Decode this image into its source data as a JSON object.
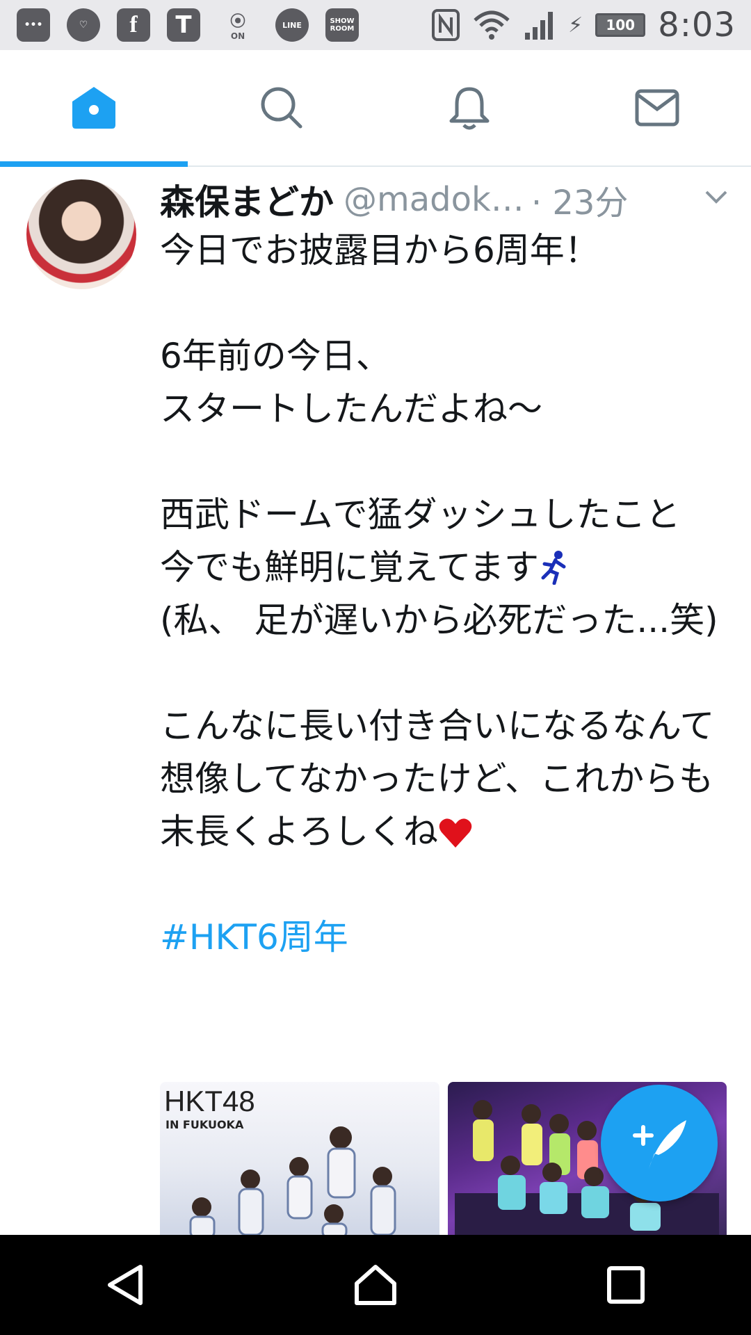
{
  "status_bar": {
    "icons": [
      "more-icon",
      "heart-app-icon",
      "facebook-icon",
      "t-app-icon",
      "voice-on-icon",
      "line-icon",
      "showroom-icon"
    ],
    "line_label": "LINE",
    "showroom_label": "SHOW ROOM",
    "on_label": "ON",
    "battery_level": "100",
    "time": "8:03"
  },
  "top_nav": {
    "tabs": [
      "home-icon",
      "search-icon",
      "notifications-icon",
      "messages-icon"
    ],
    "active_tab": 0,
    "accent_color": "#1da1f2"
  },
  "tweet": {
    "display_name": "森保まどか",
    "handle": "@madok…",
    "time": "· 23分",
    "lines": {
      "l1": "今日でお披露目から6周年！",
      "l2": "6年前の今日、",
      "l3": "スタートしたんだよね〜",
      "l4": "西武ドームで猛ダッシュしたこと",
      "l5": "今でも鮮明に覚えてます",
      "l6": "(私、 足が遅いから必死だった...笑)",
      "l7": "こんなに長い付き合いになるなんて想像してなかったけど、これからも末長くよろしくね"
    },
    "hashtag": "#HKT6周年",
    "media": {
      "photo1_logo": "HKT48",
      "photo1_sub": "IN FUKUOKA"
    }
  },
  "fab": {
    "icon": "compose-tweet-icon"
  },
  "android_nav": {
    "buttons": [
      "back-icon",
      "home-icon",
      "recents-icon"
    ]
  }
}
